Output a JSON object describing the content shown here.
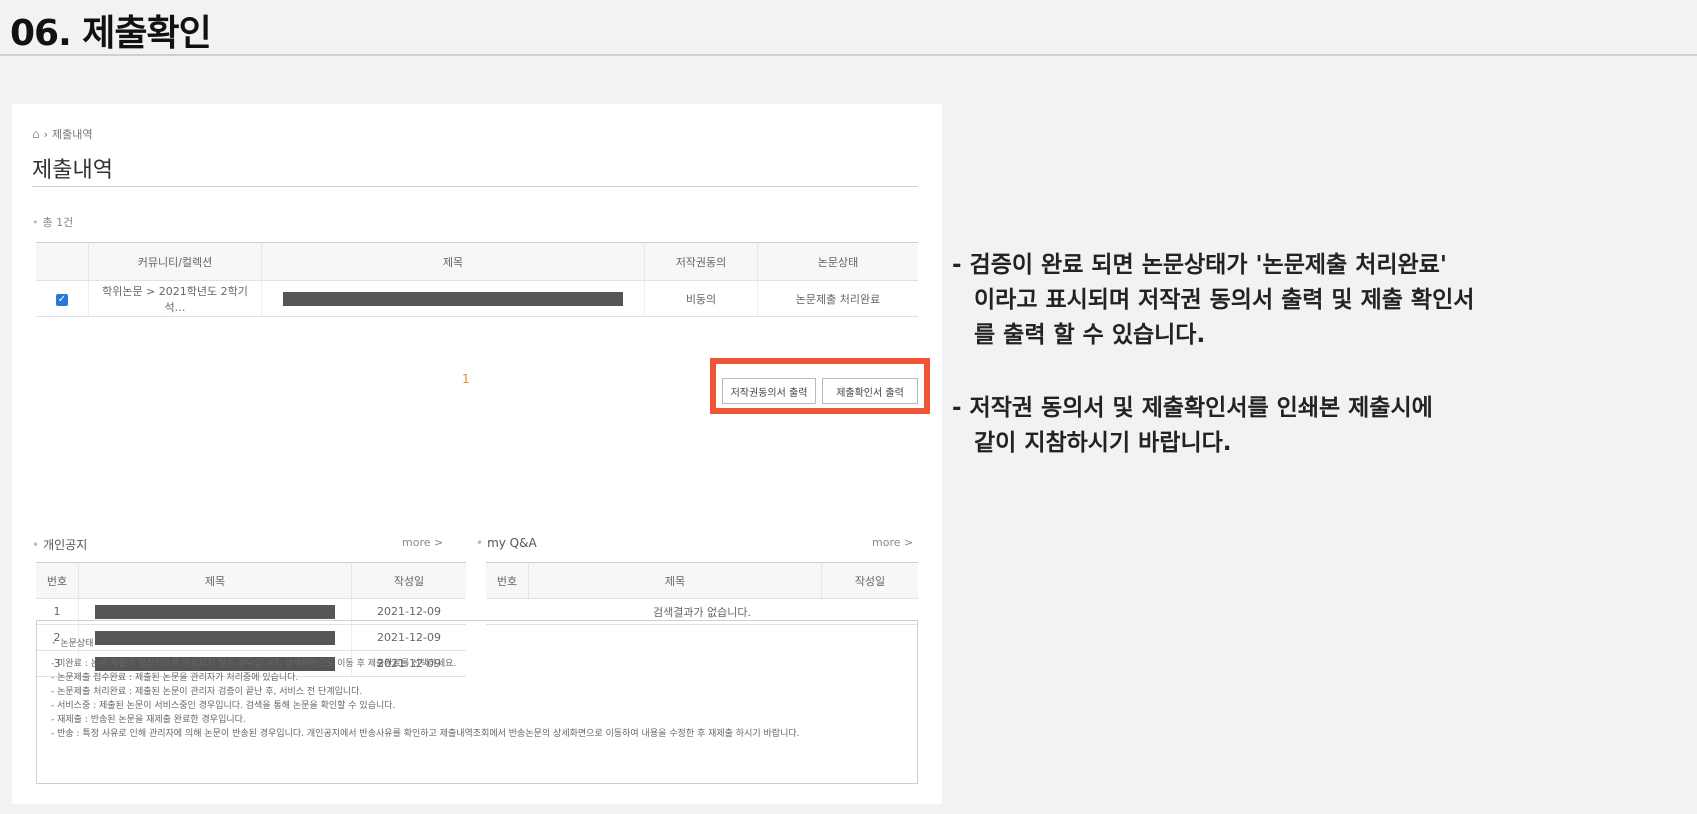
{
  "section_title": "06. 제출확인",
  "breadcrumb": {
    "home_icon": "home-icon",
    "current": "제출내역"
  },
  "page_heading": "제출내역",
  "total_label": "총 1건",
  "submissions": {
    "headers": [
      "",
      "커뮤니티/컬렉션",
      "제목",
      "저작권동의",
      "논문상태"
    ],
    "rows": [
      {
        "checked": true,
        "community": "학위논문 > 2021학년도 2학기 석…",
        "copyright": "비동의",
        "status": "논문제출 처리완료"
      }
    ]
  },
  "pagination": {
    "current": "1"
  },
  "buttons": {
    "copyright_print": "저작권동의서 출력",
    "confirm_print": "제출확인서 출력"
  },
  "notices": {
    "title": "개인공지",
    "more": "more >",
    "headers": [
      "번호",
      "제목",
      "작성일"
    ],
    "rows": [
      {
        "no": "1",
        "date": "2021-12-09"
      },
      {
        "no": "2",
        "date": "2021-12-09"
      },
      {
        "no": "3",
        "date": "2021-12-09"
      }
    ]
  },
  "qna": {
    "title": "my Q&A",
    "more": "more >",
    "headers": [
      "번호",
      "제목",
      "작성일"
    ],
    "empty": "검색결과가 없습니다."
  },
  "status_legend": {
    "title": "논문상태",
    "items": [
      "미완료 : 논문 제출이 정상적으로 완료되지 않은 경우입니다. 상세화면으로 이동 후 제출완료를 선택하세요.",
      "논문제출 접수완료 : 제출된 논문을 관리자가 처리중에 있습니다.",
      "논문제출 처리완료 : 제출된 논문이 관리자 검증이 끝난 후, 서비스 전 단계입니다.",
      "서비스중 : 제출된 논문이 서비스중인 경우입니다. 검색을 통해 논문을 확인할 수 있습니다.",
      "재제출 : 반송된 논문을 재제출 완료한 경우입니다.",
      "반송 : 특정 사유로 인해 관리자에 의해 논문이 반송된 경우입니다. 개인공지에서 반송사유를 확인하고 제출내역조회에서 반송논문의 상세화면으로 이동하여 내용을 수정한 후 재제출 하시기 바랍니다."
    ]
  },
  "description": {
    "para1": [
      "- 검증이 완료 되면 논문상태가 '논문제출 처리완료'",
      "이라고 표시되며 저작권 동의서 출력 및 제출 확인서",
      "를 출력 할 수 있습니다."
    ],
    "para2": [
      "- 저작권 동의서 및 제출확인서를 인쇄본 제출시에",
      "같이 지참하시기 바랍니다."
    ]
  }
}
